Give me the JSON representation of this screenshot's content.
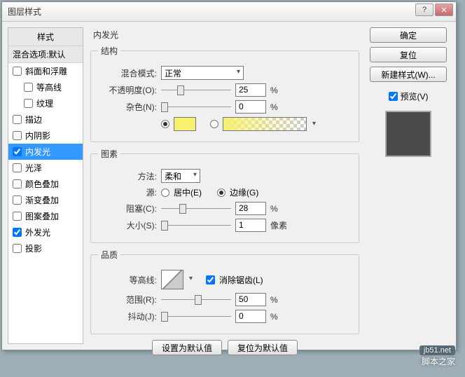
{
  "window": {
    "title": "图层样式"
  },
  "left": {
    "header": "样式",
    "blend": "混合选项:默认",
    "items": [
      {
        "label": "斜面和浮雕",
        "checked": false
      },
      {
        "label": "等高线",
        "checked": false,
        "indent": true
      },
      {
        "label": "纹理",
        "checked": false,
        "indent": true
      },
      {
        "label": "描边",
        "checked": false
      },
      {
        "label": "内阴影",
        "checked": false
      },
      {
        "label": "内发光",
        "checked": true,
        "selected": true
      },
      {
        "label": "光泽",
        "checked": false
      },
      {
        "label": "颜色叠加",
        "checked": false
      },
      {
        "label": "渐变叠加",
        "checked": false
      },
      {
        "label": "图案叠加",
        "checked": false
      },
      {
        "label": "外发光",
        "checked": true
      },
      {
        "label": "投影",
        "checked": false
      }
    ]
  },
  "center": {
    "title": "内发光",
    "groups": {
      "structure": {
        "legend": "结构",
        "blend_mode_label": "混合模式:",
        "blend_mode_value": "正常",
        "opacity_label": "不透明度(O):",
        "opacity_value": "25",
        "noise_label": "杂色(N):",
        "noise_value": "0",
        "percent": "%",
        "color_hex": "#f8f070"
      },
      "elements": {
        "legend": "图素",
        "technique_label": "方法:",
        "technique_value": "柔和",
        "source_label": "源:",
        "source_center": "居中(E)",
        "source_edge": "边缘(G)",
        "choke_label": "阻塞(C):",
        "choke_value": "28",
        "size_label": "大小(S):",
        "size_value": "1",
        "percent": "%",
        "pixels": "像素"
      },
      "quality": {
        "legend": "品质",
        "contour_label": "等高线:",
        "antialias_label": "消除锯齿(L)",
        "range_label": "范围(R):",
        "range_value": "50",
        "jitter_label": "抖动(J):",
        "jitter_value": "0",
        "percent": "%"
      }
    },
    "buttons": {
      "reset_default": "设置为默认值",
      "revert_default": "复位为默认值"
    }
  },
  "right": {
    "ok": "确定",
    "cancel": "复位",
    "new_style": "新建样式(W)...",
    "preview_label": "预览(V)"
  },
  "watermark": {
    "site": "jb51.net",
    "name": "脚本之家"
  }
}
